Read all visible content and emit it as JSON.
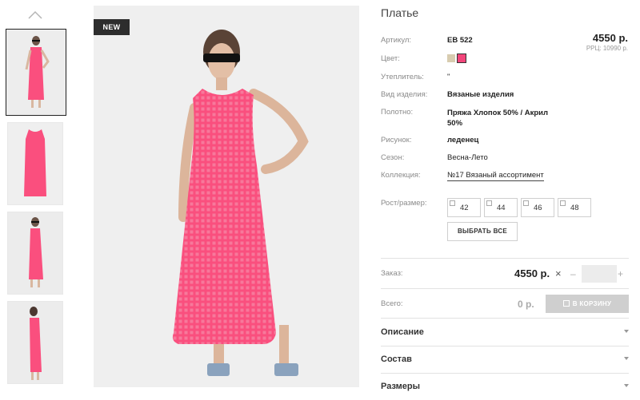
{
  "badge": "NEW",
  "product": {
    "title": "Платье",
    "price": "4550 р.",
    "rrp": "РРЦ: 10990 р."
  },
  "specs": [
    {
      "label": "Артикул:",
      "value": "EB 522"
    },
    {
      "label": "Цвет:",
      "value": ""
    },
    {
      "label": "Утеплитель:",
      "value": "\""
    },
    {
      "label": "Вид изделия:",
      "value": "Вязаные изделия"
    },
    {
      "label": "Полотно:",
      "value": "Пряжа Хлопок 50% / Акрил 50%"
    },
    {
      "label": "Рисунок:",
      "value": "леденец"
    },
    {
      "label": "Сезон:",
      "value": "Весна-Лето"
    },
    {
      "label": "Коллекция:",
      "value": "№17 Вязаный ассортимент"
    }
  ],
  "colors": [
    "#d8ccb0",
    "#f2457a"
  ],
  "sizes": {
    "label": "Рост/размер:",
    "options": [
      "42",
      "44",
      "46",
      "48"
    ],
    "select_all": "ВЫБРАТЬ ВСЕ"
  },
  "order": {
    "label": "Заказ:",
    "price": "4550 р.",
    "times": "×",
    "minus": "–",
    "plus": "+"
  },
  "total": {
    "label": "Всего:",
    "value": "0 р.",
    "cart_button": "В КОРЗИНУ"
  },
  "accordions": [
    "Описание",
    "Состав",
    "Размеры"
  ],
  "colors_theme": {
    "dress": "#fa4f7e",
    "badge_bg": "#2d2d2d"
  }
}
